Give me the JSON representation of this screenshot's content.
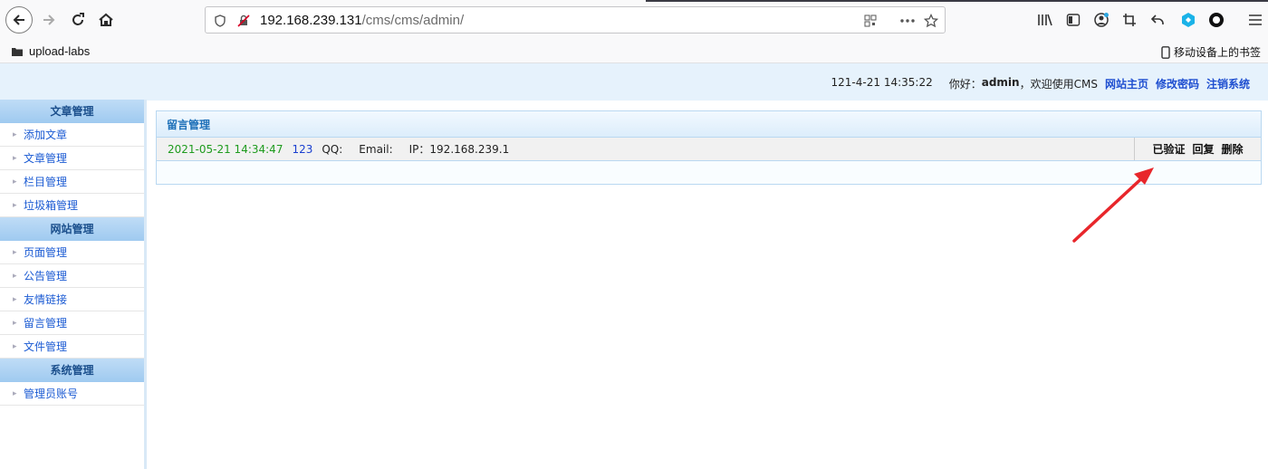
{
  "browser": {
    "url_host": "192.168.239.131",
    "url_path": "/cms/cms/admin/",
    "bookmark": "upload-labs",
    "mobile_bookmarks": "移动设备上的书签"
  },
  "header": {
    "time": "121-4-21 14:35:22",
    "greeting_prefix": "你好：",
    "user": "admin",
    "greeting_suffix": "，欢迎使用CMS",
    "links": [
      "网站主页",
      "修改密码",
      "注销系统"
    ]
  },
  "sidebar": {
    "groups": [
      {
        "title": "文章管理",
        "items": [
          "添加文章",
          "文章管理",
          "栏目管理",
          "垃圾箱管理"
        ]
      },
      {
        "title": "网站管理",
        "items": [
          "页面管理",
          "公告管理",
          "友情链接",
          "留言管理",
          "文件管理"
        ]
      },
      {
        "title": "系统管理",
        "items": [
          "管理员账号"
        ]
      }
    ]
  },
  "main": {
    "panel_title": "留言管理",
    "message": {
      "date": "2021-05-21 14:34:47",
      "name": "123",
      "qq": "QQ:",
      "email": "Email:",
      "ip": "IP：192.168.239.1",
      "actions": [
        "已验证",
        "回复",
        "删除"
      ]
    }
  },
  "colors": {
    "accent": "#1c6fb8",
    "link": "#1a5ad3",
    "arrow": "#e8262b"
  }
}
